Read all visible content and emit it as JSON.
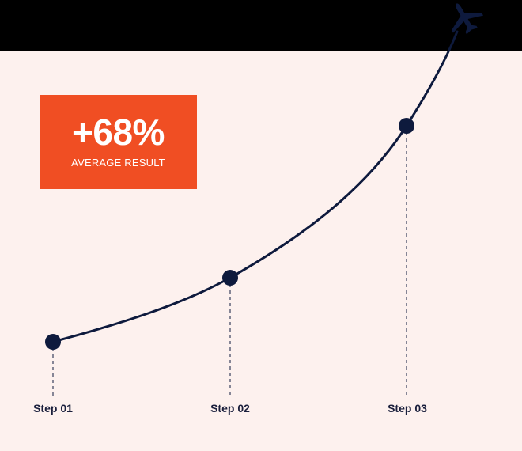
{
  "stat": {
    "value": "+68%",
    "caption": "AVERAGE RESULT"
  },
  "steps": [
    {
      "label": "Step 01"
    },
    {
      "label": "Step 02"
    },
    {
      "label": "Step 03"
    }
  ],
  "colors": {
    "background": "#fdf1ee",
    "band": "#000000",
    "accent": "#f04e23",
    "line": "#0e1a3d",
    "text": "#1a1f3c"
  },
  "icons": {
    "end": "airplane-icon"
  }
}
